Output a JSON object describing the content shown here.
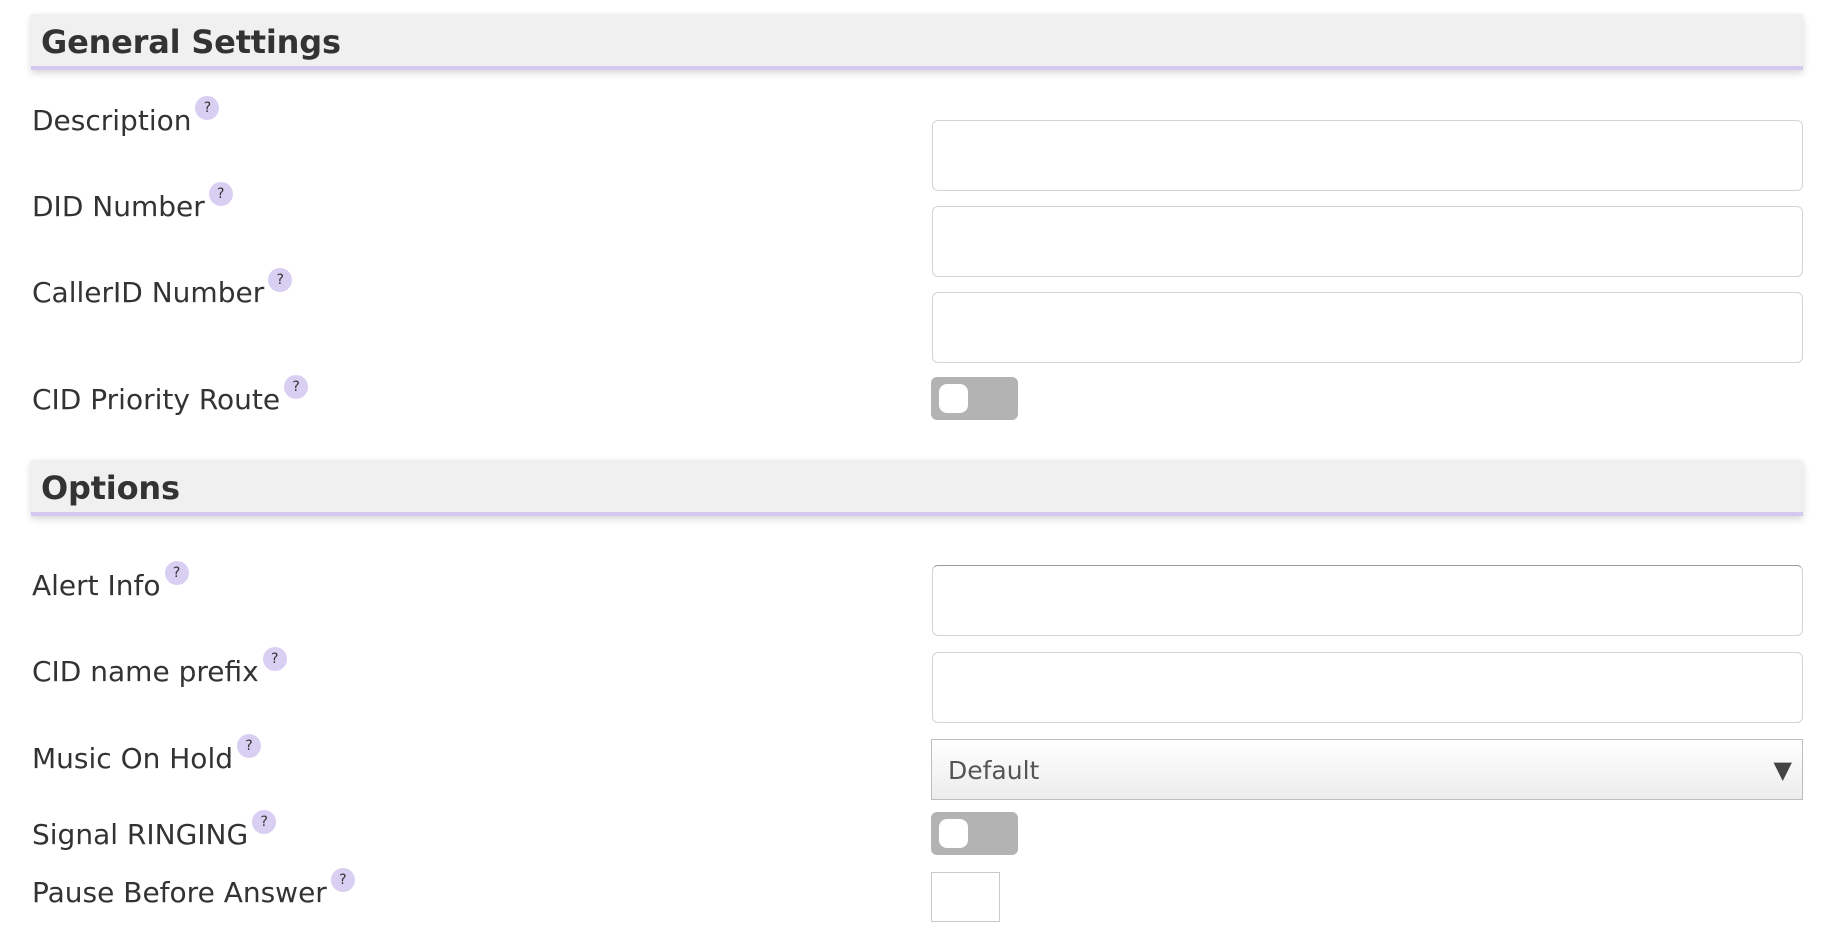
{
  "sections": {
    "general": {
      "title": "General Settings",
      "fields": {
        "description": {
          "label": "Description",
          "value": ""
        },
        "did_number": {
          "label": "DID Number",
          "value": ""
        },
        "callerid_number": {
          "label": "CallerID Number",
          "value": ""
        },
        "cid_priority_route": {
          "label": "CID Priority Route",
          "enabled": false
        }
      }
    },
    "options": {
      "title": "Options",
      "fields": {
        "alert_info": {
          "label": "Alert Info",
          "value": ""
        },
        "cid_name_prefix": {
          "label": "CID name prefix",
          "value": ""
        },
        "music_on_hold": {
          "label": "Music On Hold",
          "selected": "Default"
        },
        "signal_ringing": {
          "label": "Signal RINGING",
          "enabled": false
        },
        "pause_before_answer": {
          "label": "Pause Before Answer",
          "value": ""
        }
      }
    }
  },
  "help_icon_glyph": "?",
  "select_arrow_glyph": "▼",
  "colors": {
    "accent": "#d3c8ee",
    "help_icon_bg": "#d8cff3",
    "toggle_off": "#b3b3b3",
    "header_bg": "#f0f0f0"
  },
  "icons": {
    "help": "question-mark-circle-icon",
    "dropdown": "triangle-down-icon"
  }
}
